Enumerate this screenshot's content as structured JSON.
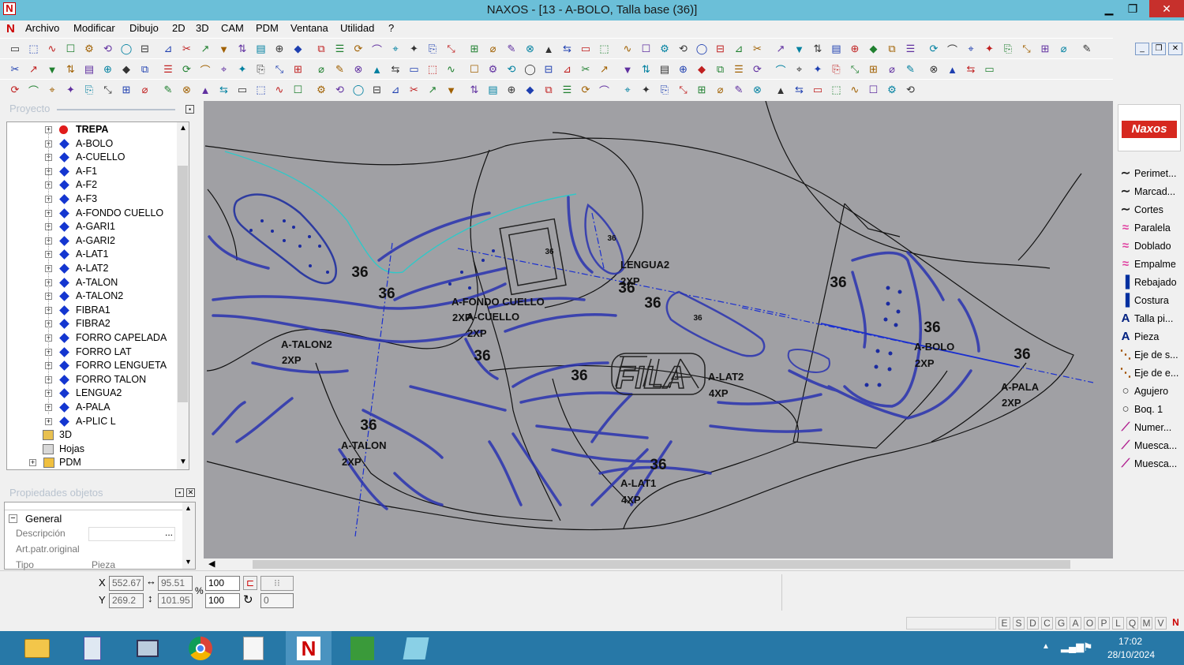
{
  "window": {
    "title": "NAXOS - [13 - A-BOLO, Talla base (36)]",
    "min": "▁",
    "restore": "❐",
    "close": "✕"
  },
  "menu": [
    "Archivo",
    "Modificar",
    "Dibujo",
    "2D",
    "3D",
    "CAM",
    "PDM",
    "Ventana",
    "Utilidad",
    "?"
  ],
  "mdi_controls": [
    "_",
    "❐",
    "✕"
  ],
  "panels": {
    "project_caption": "Proyecto",
    "props_caption": "Propiedades objetos"
  },
  "tree": {
    "root": "TREPA",
    "items": [
      "A-BOLO",
      "A-CUELLO",
      "A-F1",
      "A-F2",
      "A-F3",
      "A-FONDO CUELLO",
      "A-GARI1",
      "A-GARI2",
      "A-LAT1",
      "A-LAT2",
      "A-TALON",
      "A-TALON2",
      "FIBRA1",
      "FIBRA2",
      "FORRO CAPELADA",
      "FORRO LAT",
      "FORRO LENGUETA",
      "FORRO TALON",
      "LENGUA2",
      "A-PALA",
      "A-PLIC L"
    ],
    "tail": [
      "3D",
      "Hojas",
      "PDM"
    ]
  },
  "properties": {
    "section": "General",
    "rows": [
      {
        "label": "Descripción",
        "value": "",
        "btn": "..."
      },
      {
        "label": "Art.patr.original",
        "value": ""
      },
      {
        "label": "Tipo",
        "value": "Pieza"
      }
    ]
  },
  "right_tools": [
    "Perimet...",
    "Marcad...",
    "Cortes",
    "Paralela",
    "Doblado",
    "Empalme",
    "Rebajado",
    "Costura",
    "Talla pi...",
    "Pieza",
    "Eje de s...",
    "Eje de e...",
    "Agujero",
    "Boq. 1",
    "Numer...",
    "Muesca...",
    "Muesca..."
  ],
  "logo": "Naxos",
  "canvas_labels": {
    "sizes": [
      "36",
      "36",
      "36",
      "36",
      "36",
      "36",
      "36",
      "36",
      "36",
      "36",
      "36",
      "36",
      "36",
      "36"
    ],
    "pieces": [
      "A-TALON2",
      "2XP",
      "A-FONDO CUELLO",
      "2XP",
      "A-CUELLO",
      "2XP",
      "LENGUA2",
      "2XP",
      "A-LAT2",
      "4XP",
      "A-BOLO",
      "2XP",
      "A-PALA",
      "2XP",
      "A-TALON",
      "2XP",
      "A-LAT1",
      "4XP"
    ],
    "brand": "FILA"
  },
  "coords": {
    "x_label": "X",
    "y_label": "Y",
    "x": "552.67",
    "y": "269.2",
    "w": "95.51",
    "h": "101.95",
    "sx": "100",
    "sy": "100",
    "pct": "%",
    "rot": "0"
  },
  "status_letters": [
    "E",
    "S",
    "D",
    "C",
    "G",
    "A",
    "O",
    "P",
    "L",
    "Q",
    "M",
    "V"
  ],
  "clock": {
    "time": "17:02",
    "date": "28/10/2024"
  }
}
